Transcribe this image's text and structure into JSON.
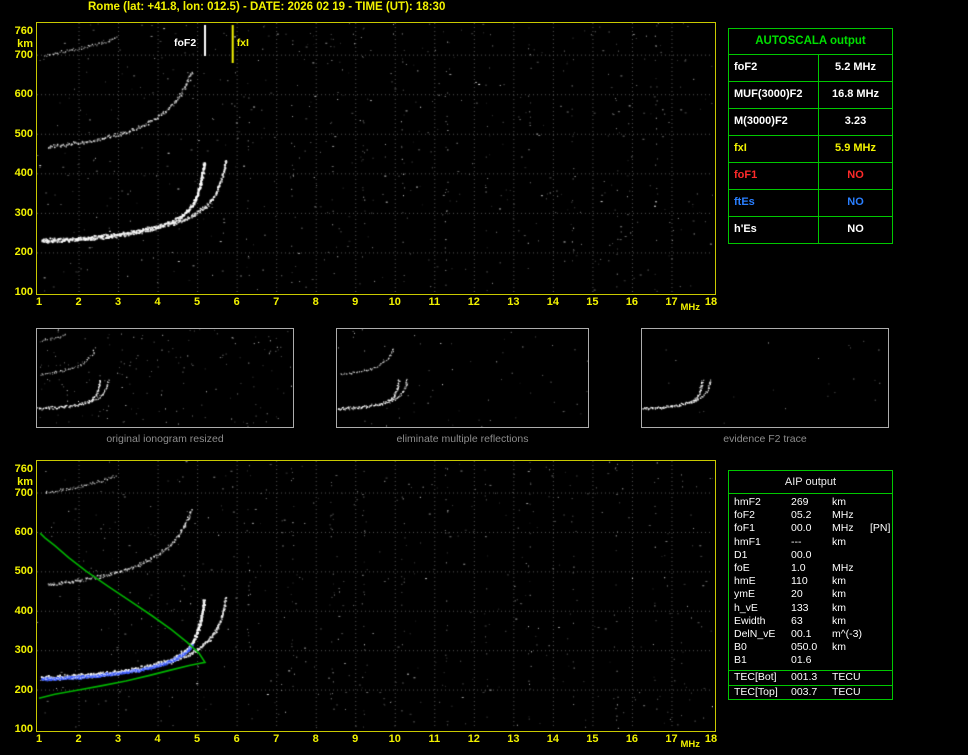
{
  "header": {
    "title": "Rome (lat: +41.8, lon: 012.5) - DATE: 2026 02 19 - TIME (UT): 18:30"
  },
  "axis": {
    "x_unit": "MHz",
    "y_unit": "km"
  },
  "ionogram": {
    "fof2_label": "foF2",
    "fxi_label": "fxI"
  },
  "autoscala_table": {
    "title": "AUTOSCALA output",
    "rows": [
      {
        "label": "foF2",
        "value": "5.2 MHz",
        "color": "#ffffff"
      },
      {
        "label": "MUF(3000)F2",
        "value": "16.8 MHz",
        "color": "#ffffff"
      },
      {
        "label": "M(3000)F2",
        "value": "3.23",
        "color": "#ffffff"
      },
      {
        "label": "fxI",
        "value": "5.9 MHz",
        "color": "#f2f200"
      },
      {
        "label": "foF1",
        "value": "NO",
        "color": "#ff2a2a"
      },
      {
        "label": "ftEs",
        "value": "NO",
        "color": "#2a7fff"
      },
      {
        "label": "h'Es",
        "value": "NO",
        "color": "#ffffff"
      }
    ]
  },
  "thumbnails": [
    {
      "caption": "original ionogram resized"
    },
    {
      "caption": "eliminate multiple reflections"
    },
    {
      "caption": "evidence F2 trace"
    }
  ],
  "aip_table": {
    "title": "AIP output",
    "rows": [
      {
        "label": "hmF2",
        "value": "269",
        "unit": "km",
        "extra": ""
      },
      {
        "label": "foF2",
        "value": "05.2",
        "unit": "MHz",
        "extra": ""
      },
      {
        "label": "foF1",
        "value": "00.0",
        "unit": "MHz",
        "extra": "[PN]"
      },
      {
        "label": "hmF1",
        "value": "---",
        "unit": "km",
        "extra": ""
      },
      {
        "label": "D1",
        "value": "00.0",
        "unit": "",
        "extra": ""
      },
      {
        "label": "foE",
        "value": "1.0",
        "unit": "MHz",
        "extra": ""
      },
      {
        "label": "hmE",
        "value": "110",
        "unit": "km",
        "extra": ""
      },
      {
        "label": "ymE",
        "value": "20",
        "unit": "km",
        "extra": ""
      },
      {
        "label": "h_vE",
        "value": "133",
        "unit": "km",
        "extra": ""
      },
      {
        "label": "Ewidth",
        "value": "63",
        "unit": "km",
        "extra": ""
      },
      {
        "label": "DelN_vE",
        "value": "00.1",
        "unit": "m^(-3)",
        "extra": ""
      },
      {
        "label": "B0",
        "value": "050.0",
        "unit": "km",
        "extra": ""
      },
      {
        "label": "B1",
        "value": "01.6",
        "unit": "",
        "extra": ""
      }
    ],
    "tec_rows": [
      {
        "label": "TEC[Bot]",
        "value": "001.3",
        "unit": "TECU",
        "extra": ""
      },
      {
        "label": "TEC[Top]",
        "value": "003.7",
        "unit": "TECU",
        "extra": ""
      }
    ]
  },
  "chart_data": {
    "type": "scatter",
    "title": "Rome ionogram 2026-02-19 18:30 UT with autoscaled parameters and electron density profile",
    "xlabel": "MHz",
    "ylabel": "km",
    "xlim": [
      1,
      18
    ],
    "ylim": [
      100,
      780
    ],
    "grid": true,
    "x_ticks": [
      1,
      2,
      3,
      4,
      5,
      6,
      7,
      8,
      9,
      10,
      11,
      12,
      13,
      14,
      15,
      16,
      17,
      18
    ],
    "y_ticks": [
      760,
      700,
      600,
      500,
      400,
      300,
      200,
      100
    ],
    "autoscaled": {
      "foF2_MHz": 5.2,
      "fxI_MHz": 5.9,
      "MUF3000_F2_MHz": 16.8,
      "M3000_F2": 3.23
    },
    "traces": {
      "f2_ordinary": [
        [
          1.05,
          231
        ],
        [
          1.5,
          233
        ],
        [
          2.0,
          236
        ],
        [
          2.5,
          240
        ],
        [
          3.0,
          246
        ],
        [
          3.5,
          254
        ],
        [
          3.9,
          263
        ],
        [
          4.25,
          274
        ],
        [
          4.55,
          288
        ],
        [
          4.75,
          305
        ],
        [
          4.9,
          325
        ],
        [
          5.0,
          350
        ],
        [
          5.08,
          378
        ],
        [
          5.13,
          405
        ],
        [
          5.17,
          430
        ]
      ],
      "f2_extraordinary": [
        [
          4.35,
          272
        ],
        [
          4.7,
          286
        ],
        [
          5.0,
          302
        ],
        [
          5.25,
          322
        ],
        [
          5.45,
          348
        ],
        [
          5.58,
          378
        ],
        [
          5.67,
          408
        ],
        [
          5.72,
          435
        ]
      ],
      "second_hop": [
        [
          1.2,
          468
        ],
        [
          1.7,
          474
        ],
        [
          2.2,
          482
        ],
        [
          2.7,
          492
        ],
        [
          3.2,
          505
        ],
        [
          3.6,
          521
        ],
        [
          3.95,
          540
        ],
        [
          4.25,
          562
        ],
        [
          4.5,
          590
        ],
        [
          4.7,
          622
        ],
        [
          4.85,
          658
        ]
      ],
      "third_hop": [
        [
          1.15,
          700
        ],
        [
          1.6,
          708
        ],
        [
          2.1,
          718
        ],
        [
          2.55,
          730
        ],
        [
          2.95,
          744
        ]
      ],
      "restored_trace": [
        [
          1.05,
          228
        ],
        [
          1.5,
          230
        ],
        [
          2.0,
          233
        ],
        [
          2.5,
          237
        ],
        [
          3.0,
          243
        ],
        [
          3.5,
          251
        ],
        [
          3.9,
          260
        ],
        [
          4.25,
          271
        ],
        [
          4.55,
          285
        ],
        [
          4.75,
          300
        ],
        [
          4.88,
          315
        ]
      ],
      "density_profile_bottomside": [
        [
          1.0,
          178
        ],
        [
          1.4,
          188
        ],
        [
          2.0,
          199
        ],
        [
          2.6,
          210
        ],
        [
          3.2,
          222
        ],
        [
          3.8,
          236
        ],
        [
          4.35,
          250
        ],
        [
          4.8,
          261
        ],
        [
          5.05,
          266
        ],
        [
          5.2,
          269
        ]
      ],
      "density_profile_topside": [
        [
          5.2,
          269
        ],
        [
          5.05,
          292
        ],
        [
          4.75,
          320
        ],
        [
          4.35,
          352
        ],
        [
          3.85,
          388
        ],
        [
          3.3,
          425
        ],
        [
          2.75,
          462
        ],
        [
          2.2,
          500
        ],
        [
          1.75,
          535
        ],
        [
          1.4,
          565
        ],
        [
          1.15,
          585
        ],
        [
          1.03,
          597
        ]
      ]
    },
    "noise_columns_MHz": [
      6.3,
      7.4,
      8.4,
      9.2,
      10.2,
      11.3,
      12.3,
      13.4,
      14.5,
      15.6,
      16.6
    ],
    "noise_seed": 20260219
  }
}
